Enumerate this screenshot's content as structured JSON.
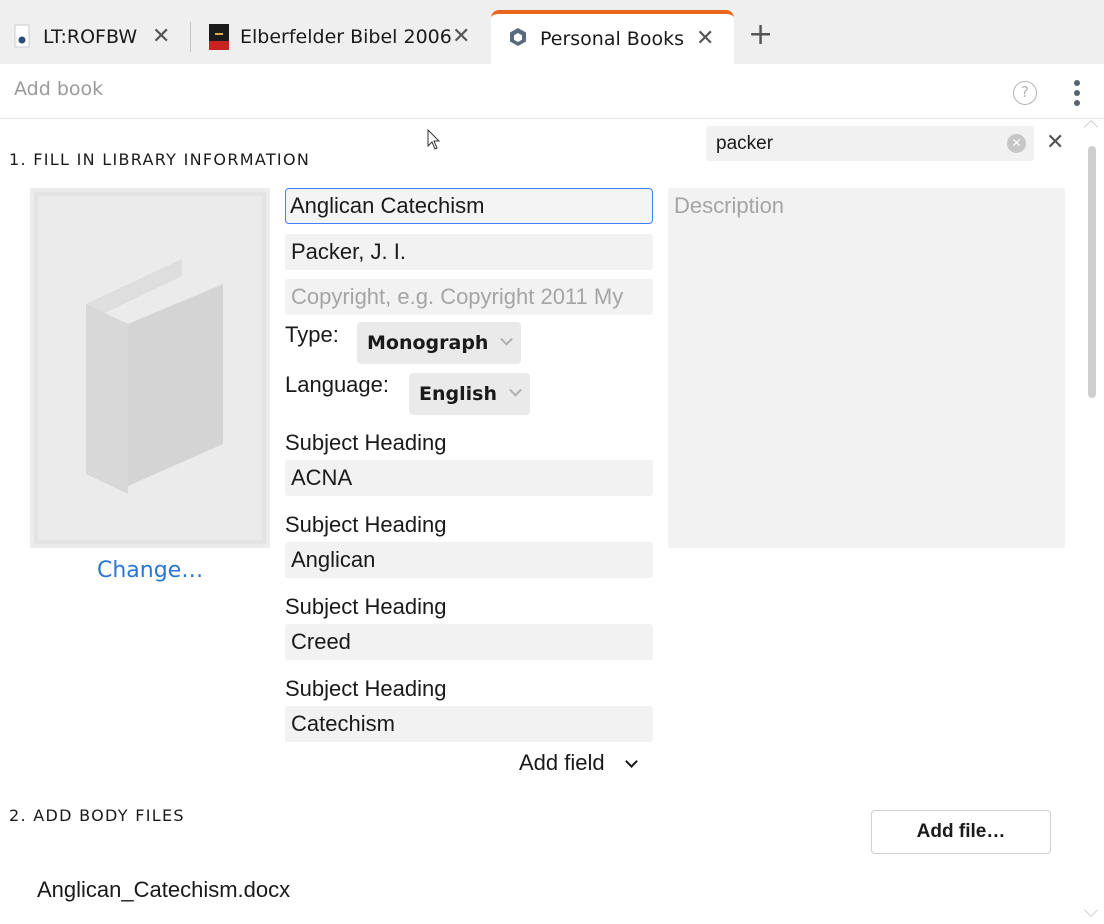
{
  "tabs": [
    {
      "label": "LT:ROFBW",
      "icon": "book-page-icon"
    },
    {
      "label": "Elberfelder Bibel 2006",
      "icon": "bible-cover-icon"
    },
    {
      "label": "Personal Books",
      "icon": "hexagon-icon",
      "active": true
    }
  ],
  "toolbar": {
    "title": "Add book",
    "help": "?"
  },
  "search": {
    "value": "packer"
  },
  "section1": {
    "title": "1. FILL IN LIBRARY INFORMATION"
  },
  "book": {
    "title": "Anglican Catechism",
    "author": "Packer, J. I.",
    "copyright_placeholder": "Copyright, e.g. Copyright 2011 My",
    "description_placeholder": "Description",
    "type_label": "Type:",
    "type_value": "Monograph",
    "language_label": "Language:",
    "language_value": "English",
    "cover_change": "Change…"
  },
  "subjects": [
    {
      "label": "Subject Heading",
      "value": "ACNA"
    },
    {
      "label": "Subject Heading",
      "value": "Anglican"
    },
    {
      "label": "Subject Heading",
      "value": "Creed"
    },
    {
      "label": "Subject Heading",
      "value": "Catechism"
    }
  ],
  "add_field": "Add field",
  "section2": {
    "title": "2. ADD BODY FILES",
    "add_file": "Add file…"
  },
  "files": [
    "Anglican_Catechism.docx"
  ],
  "colors": {
    "accent": "#e8671c",
    "link": "#2a76d2",
    "focus": "#3b82f6"
  }
}
